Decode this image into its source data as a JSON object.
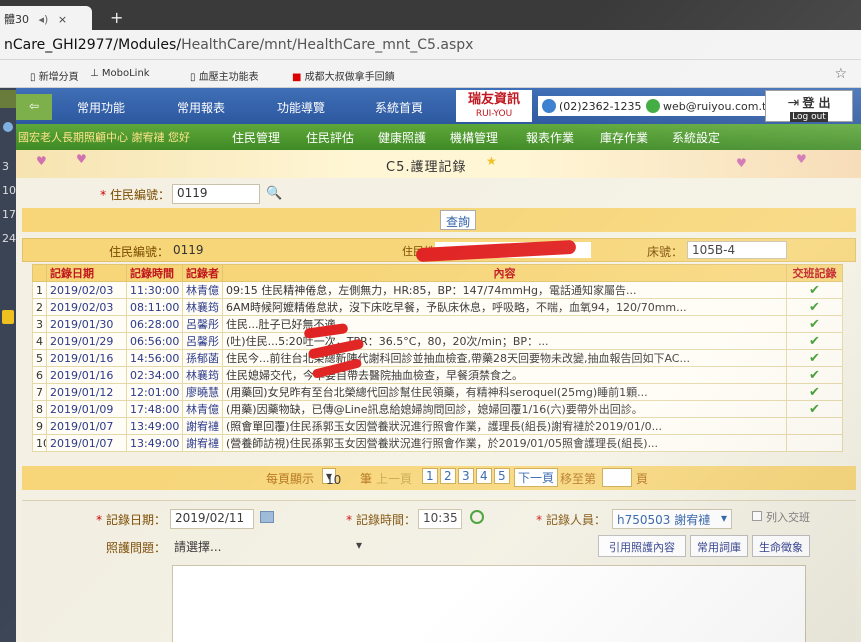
{
  "browser": {
    "tab_title": "體30",
    "tab_close": "×",
    "new_tab": "+",
    "url_prefix": "nCare_GHI2977/Modules/",
    "url_rest": "HealthCare/mnt/HealthCare_mnt_C5.aspx",
    "bookmarks": [
      "新增分頁",
      "MoboLink",
      "血壓主功能表",
      "成都大叔做拿手回饋"
    ],
    "star": "☆"
  },
  "left_numbers": [
    "3",
    "10",
    "17",
    "24"
  ],
  "topnav": {
    "items": [
      "常用功能",
      "常用報表",
      "功能導覽",
      "系統首頁"
    ],
    "logo_main": "瑞友資訊",
    "logo_sub": "RUI-YOU",
    "phone": "(02)2362-1235",
    "web": "web@ruiyou.com.tw",
    "logout_cn": "登 出",
    "logout_en": "Log out"
  },
  "greennav": {
    "greeting": "國宏老人長期照顧中心 謝宥褳 您好",
    "items": [
      "住民管理",
      "住民評估",
      "健康照護",
      "機構管理",
      "報表作業",
      "庫存作業",
      "系統設定"
    ]
  },
  "page_title": "C5.護理記錄",
  "search": {
    "resident_id_label": "住民編號",
    "resident_id_value": "0119",
    "query_button": "查詢"
  },
  "info": {
    "resident_id_label": "住民編號",
    "resident_id_value": "0119",
    "resident_name_label": "住民姓",
    "bed_label": "床號",
    "bed_value": "105B-4"
  },
  "table": {
    "headers": [
      "記錄日期",
      "記錄時間",
      "記錄者",
      "內容",
      "交班記錄"
    ],
    "rows": [
      {
        "idx": "1",
        "date": "2019/02/03",
        "time": "11:30:00",
        "who": "林青億",
        "content": "09:15 住民精神倦怠，左側無力，HR:85，BP：147/74mmHg，電話通知家屬告...",
        "mark": "✔"
      },
      {
        "idx": "2",
        "date": "2019/02/03",
        "time": "08:11:00",
        "who": "林襄筠",
        "content": "6AM時候阿嬤精倦怠狀，沒下床吃早餐，予臥床休息，呼吸略，不喘，血氧94，120/70mm...",
        "mark": "✔"
      },
      {
        "idx": "3",
        "date": "2019/01/30",
        "time": "06:28:00",
        "who": "呂馨彤",
        "content": "住民...肚子已好無不適。",
        "mark": "✔"
      },
      {
        "idx": "4",
        "date": "2019/01/29",
        "time": "06:56:00",
        "who": "呂馨彤",
        "content": "(吐)住民...5:20吐一次，TPR：36.5°C，80，20次/min；BP：...",
        "mark": "✔"
      },
      {
        "idx": "5",
        "date": "2019/01/16",
        "time": "14:56:00",
        "who": "孫郁菡",
        "content": "住民今...前往台北榮總新陳代謝科回診並抽血檢查,帶藥28天回要物未改變,抽血報告回如下AC...",
        "mark": "✔"
      },
      {
        "idx": "6",
        "date": "2019/01/16",
        "time": "02:34:00",
        "who": "林襄筠",
        "content": "住民媳婦交代，今早要自帶去醫院抽血檢查，早餐須禁食之。",
        "mark": "✔"
      },
      {
        "idx": "7",
        "date": "2019/01/12",
        "time": "12:01:00",
        "who": "廖曉慧",
        "content": "(用藥回)女兒昨有至台北榮總代回診幫住民領藥，有精神科seroquel(25mg)睡前1顆...",
        "mark": "✔"
      },
      {
        "idx": "8",
        "date": "2019/01/09",
        "time": "17:48:00",
        "who": "林青億",
        "content": "(用藥)因藥物缺，已傳@Line訊息給媳婦詢問回診，媳婦回覆1/16(六)要帶外出回診。",
        "mark": "✔"
      },
      {
        "idx": "9",
        "date": "2019/01/07",
        "time": "13:49:00",
        "who": "謝宥褳",
        "content": "(照會單回覆)住民孫郭玉女因營養狀況進行照會作業，護理長(組長)謝宥褳於2019/01/0...",
        "mark": ""
      },
      {
        "idx": "10",
        "date": "2019/01/07",
        "time": "13:49:00",
        "who": "謝宥褳",
        "content": "(營養師訪視)住民孫郭玉女因營養狀況進行照會作業，於2019/01/05照會護理長(組長)...",
        "mark": ""
      }
    ]
  },
  "pager": {
    "per_page_label": "每頁顯示",
    "per_page_value": "10",
    "unit": "筆",
    "prev": "上一頁",
    "pages": [
      "1",
      "2",
      "3",
      "4",
      "5"
    ],
    "next": "下一頁",
    "goto_label": "移至第",
    "goto_unit": "頁"
  },
  "entry": {
    "date_label": "記錄日期",
    "date_value": "2019/02/11",
    "time_label": "記錄時間",
    "time_value": "10:35",
    "staff_label": "記錄人員",
    "staff_value": "h750503 謝宥褳",
    "handover_label": "列入交班",
    "problem_label": "照護問題",
    "problem_value": "請選擇...",
    "btn_quote": "引用照護內容",
    "btn_phrases": "常用詞庫",
    "btn_vitals": "生命徵象"
  }
}
